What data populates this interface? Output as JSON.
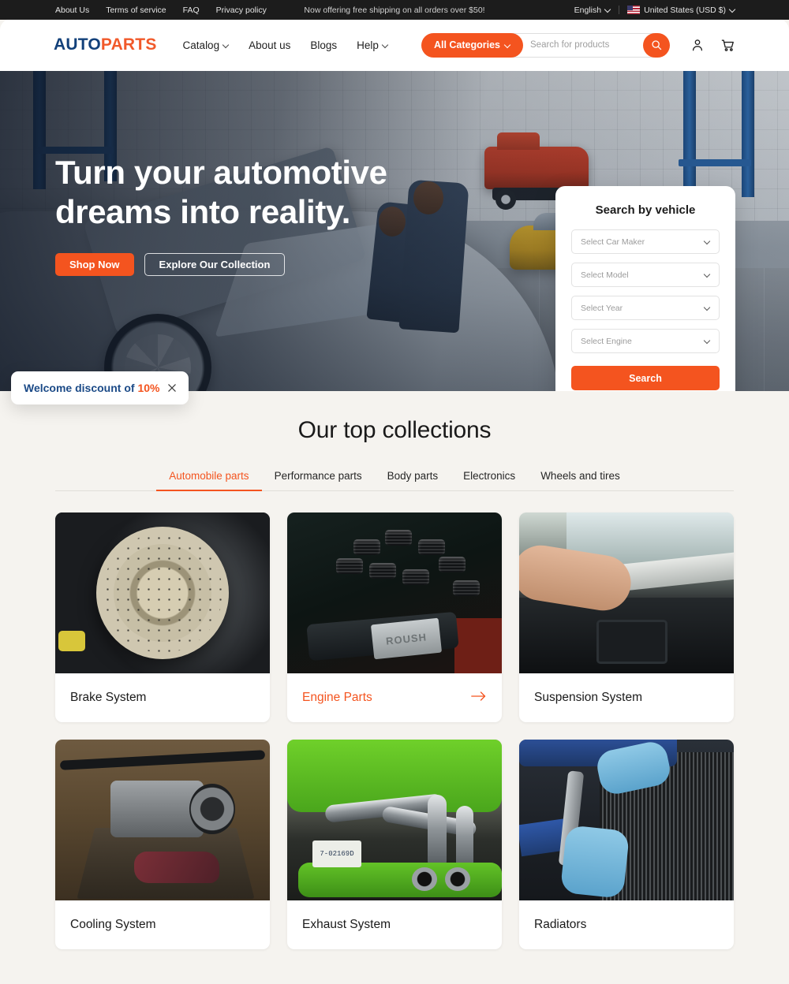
{
  "topbar": {
    "links": [
      {
        "label": "About Us"
      },
      {
        "label": "Terms of service"
      },
      {
        "label": "FAQ"
      },
      {
        "label": "Privacy policy"
      }
    ],
    "announcement": "Now offering free shipping on all orders over $50!",
    "language": "English",
    "country": "United States (USD $)"
  },
  "header": {
    "logo_first": "AUTO",
    "logo_second": "PARTS",
    "nav": [
      {
        "label": "Catalog",
        "has_caret": true
      },
      {
        "label": "About us",
        "has_caret": false
      },
      {
        "label": "Blogs",
        "has_caret": false
      },
      {
        "label": "Help",
        "has_caret": true
      }
    ],
    "all_categories_label": "All Categories",
    "search_placeholder": "Search for products",
    "search_value": "",
    "account_icon": "user-icon",
    "cart_icon": "cart-icon"
  },
  "hero": {
    "title_line1": "Turn your automotive",
    "title_line2": "dreams into reality.",
    "primary_button": "Shop Now",
    "secondary_button": "Explore Our Collection"
  },
  "vehicle_search": {
    "title": "Search by vehicle",
    "fields": [
      {
        "placeholder": "Select Car Maker",
        "value": ""
      },
      {
        "placeholder": "Select Model",
        "value": ""
      },
      {
        "placeholder": "Select Year",
        "value": ""
      },
      {
        "placeholder": "Select Engine",
        "value": ""
      }
    ],
    "button": "Search"
  },
  "toast": {
    "text": "Welcome discount of ",
    "percent": "10%",
    "close_icon": "close-icon"
  },
  "collections": {
    "title": "Our top collections",
    "tabs": [
      {
        "label": "Automobile parts",
        "active": true
      },
      {
        "label": "Performance parts",
        "active": false
      },
      {
        "label": "Body parts",
        "active": false
      },
      {
        "label": "Electronics",
        "active": false
      },
      {
        "label": "Wheels and tires",
        "active": false
      }
    ],
    "cards": [
      {
        "name": "Brake System",
        "hovered": false
      },
      {
        "name": "Engine Parts",
        "hovered": true
      },
      {
        "name": "Suspension System",
        "hovered": false
      },
      {
        "name": "Cooling System",
        "hovered": false
      },
      {
        "name": "Exhaust System",
        "hovered": false
      },
      {
        "name": "Radiators",
        "hovered": false
      }
    ],
    "engine_badge_text": "ROUSH",
    "exhaust_plate_text": "7-02169D"
  },
  "colors": {
    "accent": "#f4541f",
    "logo_blue": "#12407a",
    "toast_blue": "#1b4a87",
    "page_bg": "#f5f3ef",
    "topbar_bg": "#1c1c1c"
  }
}
